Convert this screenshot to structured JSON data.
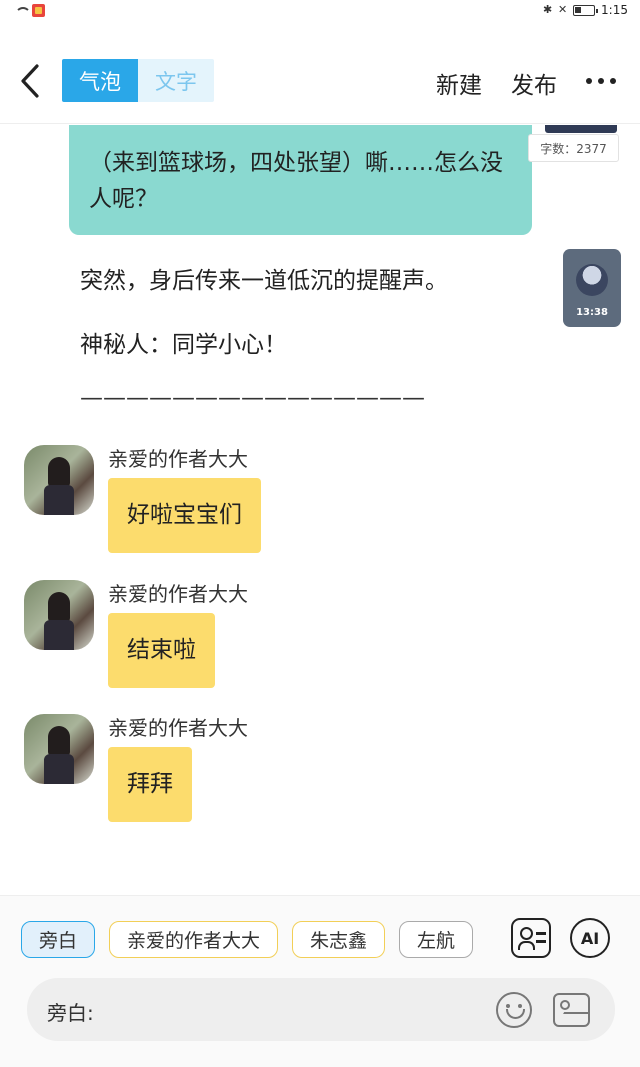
{
  "status_bar": {
    "time": "1:15"
  },
  "header": {
    "tabs": [
      {
        "label": "气泡",
        "active": true
      },
      {
        "label": "文字",
        "active": false
      }
    ],
    "new_label": "新建",
    "publish_label": "发布"
  },
  "story": {
    "teal_bubble_text": "（来到篮球场，四处张望）嘶……怎么没人呢？",
    "word_count": "字数：2377",
    "narration": [
      "突然，身后传来一道低沉的提醒声。",
      "神秘人：同学小心！",
      "———————————————"
    ],
    "video_time": "13:38",
    "messages": [
      {
        "name": "亲爱的作者大大",
        "text": "好啦宝宝们"
      },
      {
        "name": "亲爱的作者大大",
        "text": "结束啦"
      },
      {
        "name": "亲爱的作者大大",
        "text": "拜拜"
      }
    ]
  },
  "composer": {
    "roles": [
      {
        "label": "旁白",
        "selected": true
      },
      {
        "label": "亲爱的作者大大",
        "selected": false
      },
      {
        "label": "朱志鑫",
        "selected": false
      },
      {
        "label": "左航",
        "selected": false
      }
    ],
    "ai_label": "AI",
    "input_label": "旁白:",
    "input_value": "",
    "icons": [
      "role-card-icon",
      "ai-icon",
      "emoji-icon",
      "image-icon"
    ]
  },
  "colors": {
    "accent": "#2aa7e8",
    "teal_bubble": "#8ad9d0",
    "yellow_bubble": "#fcdc6d"
  }
}
